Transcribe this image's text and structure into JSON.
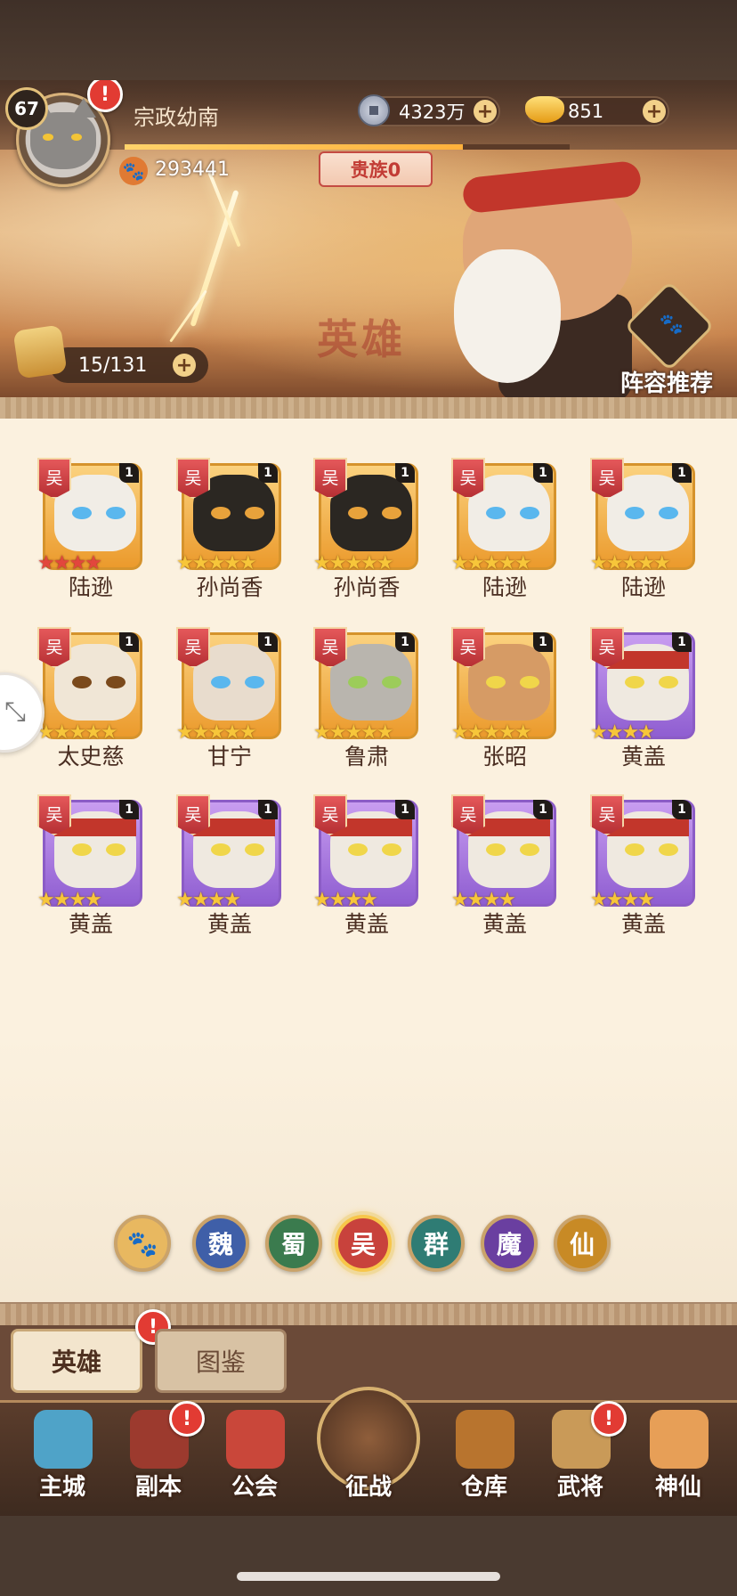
{
  "player": {
    "level": "67",
    "name": "宗政幼南",
    "coins": "4323万",
    "gold": "851",
    "paw_points": "293441",
    "noble": "贵族0",
    "xp_progress": 0.76
  },
  "banner": {
    "watermark": "英雄",
    "hero_count": "15/131",
    "recommend_label": "阵容推荐"
  },
  "heroes": [
    {
      "name": "陆逊",
      "faction": "吴",
      "level": "1",
      "stars": "★★★★",
      "star_color": "red",
      "tier": "gold"
    },
    {
      "name": "孙尚香",
      "faction": "吴",
      "level": "1",
      "stars": "★★★★★",
      "star_color": "gold",
      "tier": "gold"
    },
    {
      "name": "孙尚香",
      "faction": "吴",
      "level": "1",
      "stars": "★★★★★",
      "star_color": "gold",
      "tier": "gold"
    },
    {
      "name": "陆逊",
      "faction": "吴",
      "level": "1",
      "stars": "★★★★★",
      "star_color": "gold",
      "tier": "gold"
    },
    {
      "name": "陆逊",
      "faction": "吴",
      "level": "1",
      "stars": "★★★★★",
      "star_color": "gold",
      "tier": "gold"
    },
    {
      "name": "太史慈",
      "faction": "吴",
      "level": "1",
      "stars": "★★★★★",
      "star_color": "gold",
      "tier": "gold"
    },
    {
      "name": "甘宁",
      "faction": "吴",
      "level": "1",
      "stars": "★★★★★",
      "star_color": "gold",
      "tier": "gold"
    },
    {
      "name": "鲁肃",
      "faction": "吴",
      "level": "1",
      "stars": "★★★★★",
      "star_color": "gold",
      "tier": "gold"
    },
    {
      "name": "张昭",
      "faction": "吴",
      "level": "1",
      "stars": "★★★★★",
      "star_color": "gold",
      "tier": "gold"
    },
    {
      "name": "黄盖",
      "faction": "吴",
      "level": "1",
      "stars": "★★★★",
      "star_color": "gold",
      "tier": "epic"
    },
    {
      "name": "黄盖",
      "faction": "吴",
      "level": "1",
      "stars": "★★★★",
      "star_color": "gold",
      "tier": "epic"
    },
    {
      "name": "黄盖",
      "faction": "吴",
      "level": "1",
      "stars": "★★★★",
      "star_color": "gold",
      "tier": "epic"
    },
    {
      "name": "黄盖",
      "faction": "吴",
      "level": "1",
      "stars": "★★★★",
      "star_color": "gold",
      "tier": "epic"
    },
    {
      "name": "黄盖",
      "faction": "吴",
      "level": "1",
      "stars": "★★★★",
      "star_color": "gold",
      "tier": "epic"
    },
    {
      "name": "黄盖",
      "faction": "吴",
      "level": "1",
      "stars": "★★★★",
      "star_color": "gold",
      "tier": "epic"
    }
  ],
  "faction_filters": [
    {
      "label": "🐾",
      "bg": "#e8b860",
      "fg": "#5a3a1e"
    },
    {
      "label": "魏",
      "bg": "#3f5fa8",
      "fg": "#ffffff"
    },
    {
      "label": "蜀",
      "bg": "#3b7b4e",
      "fg": "#ffffff"
    },
    {
      "label": "吴",
      "bg": "#c8423c",
      "fg": "#ffffff",
      "active": true
    },
    {
      "label": "群",
      "bg": "#2f7c74",
      "fg": "#ffffff"
    },
    {
      "label": "魔",
      "bg": "#6a3fa0",
      "fg": "#ffffff"
    },
    {
      "label": "仙",
      "bg": "#c88a25",
      "fg": "#ffffff"
    }
  ],
  "tabs": {
    "heroes": "英雄",
    "codex": "图鉴"
  },
  "nav": [
    {
      "label": "主城",
      "color": "#4fa3c8",
      "alert": false
    },
    {
      "label": "副本",
      "color": "#9c3a2e",
      "alert": true
    },
    {
      "label": "公会",
      "color": "#c9473a",
      "alert": false
    },
    {
      "label": "征战",
      "color": "#d7b16f",
      "alert": false,
      "center": true
    },
    {
      "label": "仓库",
      "color": "#b8742e",
      "alert": false
    },
    {
      "label": "武将",
      "color": "#c99a58",
      "alert": true
    },
    {
      "label": "神仙",
      "color": "#e79f57",
      "alert": false
    }
  ],
  "icons": {
    "alert": "!",
    "plus": "+",
    "paw": "🐾",
    "float": "⤡"
  },
  "colors": {
    "accent_gold": "#f7c63a",
    "alert_red": "#e23b33",
    "content_bg": "#fbf1df"
  }
}
